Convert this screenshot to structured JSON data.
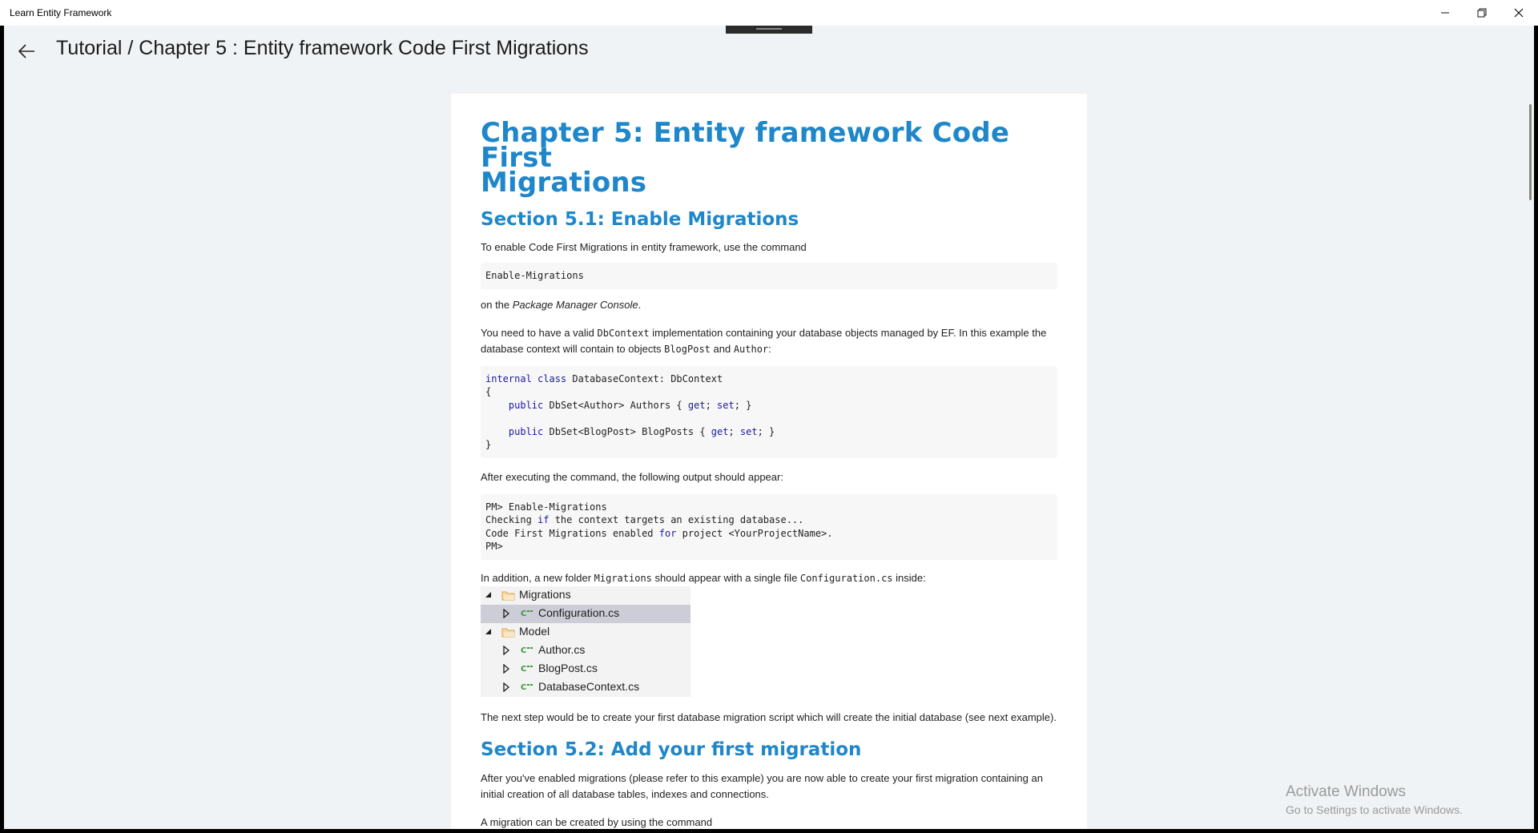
{
  "window": {
    "app_title": "Learn Entity Framework",
    "minimize_glyph": "–",
    "close_glyph": "✕"
  },
  "header": {
    "page_title": "Tutorial / Chapter 5 :  Entity framework Code First Migrations",
    "back_icon": "arrow-left-icon"
  },
  "article": {
    "chapter_title_line1": "Chapter 5: Entity framework Code First",
    "chapter_title_line2": "Migrations",
    "section1_title": "Section 5.1: Enable Migrations",
    "p_enable": "To enable Code First Migrations in entity framework, use the command",
    "code_enable": "Enable-Migrations",
    "p_on_prefix": "on the ",
    "p_on_italic": "Package Manager Console",
    "p_on_suffix": ".",
    "p_need_1": "You need to have a valid ",
    "p_need_code1": "DbContext",
    "p_need_2": " implementation containing your database objects managed by EF. In this example the database context will contain to objects ",
    "p_need_code2": "BlogPost",
    "p_need_3": " and ",
    "p_need_code3": "Author",
    "p_need_4": ":",
    "code_ctx": {
      "l1_kw1": "internal",
      "l1_kw2": "class",
      "l1_rest": " DatabaseContext: DbContext",
      "l2": "{",
      "l3_indent": "    ",
      "l3_kw": "public",
      "l3_mid": " DbSet<Author> Authors { ",
      "l3_get": "get",
      "l3_sep": "; ",
      "l3_set": "set",
      "l3_end": "; }",
      "l5_indent": "    ",
      "l5_kw": "public",
      "l5_mid": " DbSet<BlogPost> BlogPosts { ",
      "l5_get": "get",
      "l5_sep": "; ",
      "l5_set": "set",
      "l5_end": "; }",
      "l6": "}"
    },
    "p_after": "After executing the command, the following output should appear:",
    "code_out": {
      "l1": "PM> Enable-Migrations",
      "l2_a": "Checking ",
      "l2_kw": "if",
      "l2_b": " the context targets an existing database...",
      "l3_a": "Code First Migrations enabled ",
      "l3_kw": "for",
      "l3_b": " project <YourProjectName>.",
      "l4": "PM>"
    },
    "p_addition_1": "In addition, a new folder ",
    "p_addition_code1": "Migrations",
    "p_addition_2": " should appear with a single file ",
    "p_addition_code2": "Configuration.cs",
    "p_addition_3": " inside:",
    "tree": [
      {
        "label": "Migrations",
        "kind": "folder",
        "expanded": true,
        "selected": false,
        "level": 0
      },
      {
        "label": "Configuration.cs",
        "kind": "csfile",
        "expanded": false,
        "selected": true,
        "level": 1
      },
      {
        "label": "Model",
        "kind": "folder",
        "expanded": true,
        "selected": false,
        "level": 0
      },
      {
        "label": "Author.cs",
        "kind": "csfile",
        "expanded": false,
        "selected": false,
        "level": 1
      },
      {
        "label": "BlogPost.cs",
        "kind": "csfile",
        "expanded": false,
        "selected": false,
        "level": 1
      },
      {
        "label": "DatabaseContext.cs",
        "kind": "csfile",
        "expanded": false,
        "selected": false,
        "level": 1
      }
    ],
    "p_next": "The next step would be to create your first database migration script which will create the initial database (see next example).",
    "section2_title": "Section 5.2: Add your first migration",
    "p_afteryou": "After you've enabled migrations (please refer to this example) you are now able to create your first migration containing an initial creation of all database tables, indexes and connections.",
    "p_migration": "A migration can be created by using the command"
  },
  "watermark": {
    "line1": "Activate Windows",
    "line2": "Go to Settings to activate Windows."
  },
  "colors": {
    "heading": "#1f87c9",
    "keyword": "#1a1aa6",
    "page_bg": "#f0f3f5"
  }
}
